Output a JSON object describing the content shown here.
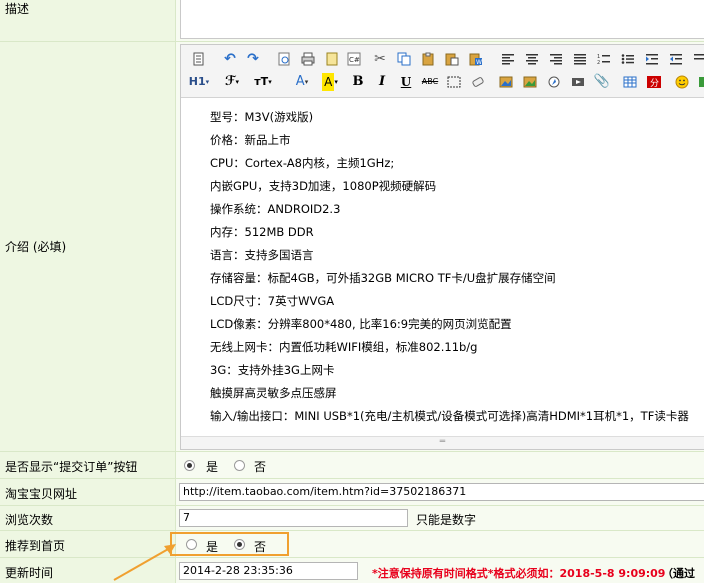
{
  "rows": {
    "desc_label": "描述",
    "intro_label": "介绍 (必填)",
    "show_order_label": "是否显示“提交订单”按钮",
    "show_order_yes": "是",
    "show_order_no": "否",
    "taobao_label": "淘宝宝贝网址",
    "taobao_value": "http://item.taobao.com/item.htm?id=37502186371",
    "views_label": "浏览次数",
    "views_value": "7",
    "views_hint": "只能是数字",
    "recommend_label": "推荐到首页",
    "recommend_yes": "是",
    "recommend_no": "否",
    "recommend_selected": "否",
    "update_label": "更新时间",
    "update_value": "2014-2-28 23:35:36",
    "update_note": "*注意保持原有时间格式*格式必须如：2018-5-8 9:09:09",
    "update_note2": "（通过"
  },
  "toolbar": {
    "h1": "H1",
    "font_family": "ℱ",
    "font_size": "тT",
    "font_color": "A",
    "bg_color": "A",
    "bold": "B",
    "italic": "I",
    "underline": "U",
    "strike": "ABC"
  },
  "content_lines": [
    "型号：M3V(游戏版)",
    "价格：新品上市",
    "CPU：Cortex-A8内核，主频1GHz;",
    "内嵌GPU，支持3D加速，1080P视频硬解码",
    "操作系统：ANDROID2.3",
    "内存：512MB DDR",
    "语言：支持多国语言",
    "存储容量：标配4GB，可外插32GB MICRO TF卡/U盘扩展存储空间",
    "LCD尺寸：7英寸WVGA",
    "LCD像素：分辨率800*480, 比率16:9完美的网页浏览配置",
    "无线上网卡：内置低功耗WIFI模组，标准802.11b/g",
    "3G：支持外挂3G上网卡",
    "触摸屏高灵敏多点压感屏",
    "输入/输出接口：MINI USB*1(充电/主机模式/设备模式可选择)高清HDMI*1耳机*1，TF读卡器"
  ],
  "colors": {
    "label_bg": "#eef7e2",
    "highlight": "#f0a030",
    "note_red": "#e8001c"
  }
}
